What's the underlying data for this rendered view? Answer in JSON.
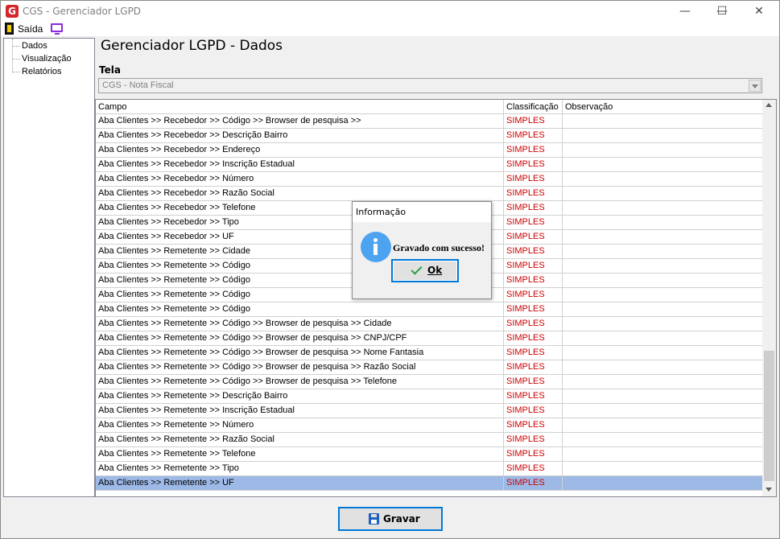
{
  "window": {
    "logo": "G",
    "title": "CGS - Gerenciador LGPD",
    "minimize_glyph": "—",
    "maximize_glyph": "☐",
    "close_glyph": "✕"
  },
  "menu": {
    "saida_label": "Saída",
    "icons": [
      "exit-icon",
      "monitor-icon"
    ]
  },
  "tree": {
    "items": [
      {
        "label": "Dados"
      },
      {
        "label": "Visualização"
      },
      {
        "label": "Relatórios"
      }
    ]
  },
  "main": {
    "title": "Gerenciador LGPD - Dados",
    "tela_label": "Tela",
    "tela_value": "CGS - Nota Fiscal"
  },
  "grid": {
    "headers": [
      "Campo",
      "Classificação",
      "Observação"
    ],
    "rows": [
      {
        "campo": "Aba Clientes >> Recebedor >> Código >> Browser de pesquisa >>",
        "classificacao": "SIMPLES",
        "observacao": ""
      },
      {
        "campo": "Aba Clientes >> Recebedor >> Descrição Bairro",
        "classificacao": "SIMPLES",
        "observacao": ""
      },
      {
        "campo": "Aba Clientes >> Recebedor >> Endereço",
        "classificacao": "SIMPLES",
        "observacao": ""
      },
      {
        "campo": "Aba Clientes >> Recebedor >> Inscrição Estadual",
        "classificacao": "SIMPLES",
        "observacao": ""
      },
      {
        "campo": "Aba Clientes >> Recebedor >> Número",
        "classificacao": "SIMPLES",
        "observacao": ""
      },
      {
        "campo": "Aba Clientes >> Recebedor >> Razão Social",
        "classificacao": "SIMPLES",
        "observacao": ""
      },
      {
        "campo": "Aba Clientes >> Recebedor >> Telefone",
        "classificacao": "SIMPLES",
        "observacao": ""
      },
      {
        "campo": "Aba Clientes >> Recebedor >> Tipo",
        "classificacao": "SIMPLES",
        "observacao": ""
      },
      {
        "campo": "Aba Clientes >> Recebedor >> UF",
        "classificacao": "SIMPLES",
        "observacao": ""
      },
      {
        "campo": "Aba Clientes >> Remetente >> Cidade",
        "classificacao": "SIMPLES",
        "observacao": ""
      },
      {
        "campo": "Aba Clientes >> Remetente >> Código",
        "classificacao": "SIMPLES",
        "observacao": ""
      },
      {
        "campo": "Aba Clientes >> Remetente >> Código",
        "classificacao": "SIMPLES",
        "observacao": ""
      },
      {
        "campo": "Aba Clientes >> Remetente >> Código",
        "classificacao": "SIMPLES",
        "observacao": ""
      },
      {
        "campo": "Aba Clientes >> Remetente >> Código",
        "classificacao": "SIMPLES",
        "observacao": ""
      },
      {
        "campo": "Aba Clientes >> Remetente >> Código >> Browser de pesquisa >> Cidade",
        "classificacao": "SIMPLES",
        "observacao": ""
      },
      {
        "campo": "Aba Clientes >> Remetente >> Código >> Browser de pesquisa >> CNPJ/CPF",
        "classificacao": "SIMPLES",
        "observacao": ""
      },
      {
        "campo": "Aba Clientes >> Remetente >> Código >> Browser de pesquisa >> Nome Fantasia",
        "classificacao": "SIMPLES",
        "observacao": ""
      },
      {
        "campo": "Aba Clientes >> Remetente >> Código >> Browser de pesquisa >> Razão Social",
        "classificacao": "SIMPLES",
        "observacao": ""
      },
      {
        "campo": "Aba Clientes >> Remetente >> Código >> Browser de pesquisa >> Telefone",
        "classificacao": "SIMPLES",
        "observacao": ""
      },
      {
        "campo": "Aba Clientes >> Remetente >> Descrição Bairro",
        "classificacao": "SIMPLES",
        "observacao": ""
      },
      {
        "campo": "Aba Clientes >> Remetente >> Inscrição Estadual",
        "classificacao": "SIMPLES",
        "observacao": ""
      },
      {
        "campo": "Aba Clientes >> Remetente >> Número",
        "classificacao": "SIMPLES",
        "observacao": ""
      },
      {
        "campo": "Aba Clientes >> Remetente >> Razão Social",
        "classificacao": "SIMPLES",
        "observacao": ""
      },
      {
        "campo": "Aba Clientes >> Remetente >> Telefone",
        "classificacao": "SIMPLES",
        "observacao": ""
      },
      {
        "campo": "Aba Clientes >> Remetente >> Tipo",
        "classificacao": "SIMPLES",
        "observacao": ""
      },
      {
        "campo": "Aba Clientes >> Remetente >> UF",
        "classificacao": "SIMPLES",
        "observacao": "",
        "selected": true
      }
    ]
  },
  "footer": {
    "gravar_label": "Gravar"
  },
  "dialog": {
    "title": "Informação",
    "message": "Gravado com sucesso!",
    "ok_label": "Ok"
  },
  "colors": {
    "classification": "#cc0000",
    "selection": "#9db9e6",
    "focus_border": "#0078d7",
    "info_icon": "#4da3f0"
  }
}
